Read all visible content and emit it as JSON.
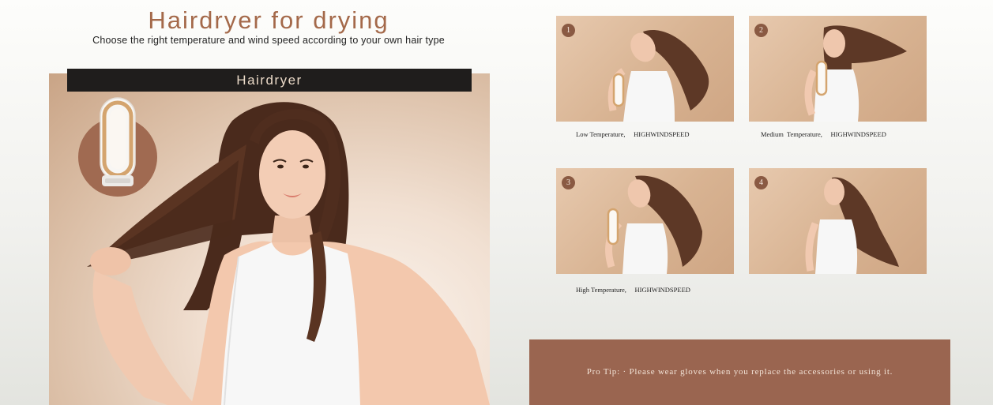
{
  "header": {
    "title": "Hairdryer for drying",
    "subtitle": "Choose the right temperature and wind speed according to your own hair type"
  },
  "hero": {
    "bar_label": "Hairdryer"
  },
  "steps": [
    {
      "number": "1",
      "caption": "Low Temperature,     HIGHWINDSPEED"
    },
    {
      "number": "2",
      "caption": "Medium  Temperature,     HIGHWINDSPEED"
    },
    {
      "number": "3",
      "caption": "High Temperature,     HIGHWINDSPEED"
    },
    {
      "number": "4",
      "caption": ""
    }
  ],
  "tip": {
    "text": "Pro Tip: · Please wear gloves when you replace the accessories or using it."
  },
  "colors": {
    "title": "#a4694a",
    "accent_brown": "#9a6550",
    "bar_dark": "#1f1d1c",
    "backdrop_tan": "#d8b392"
  }
}
